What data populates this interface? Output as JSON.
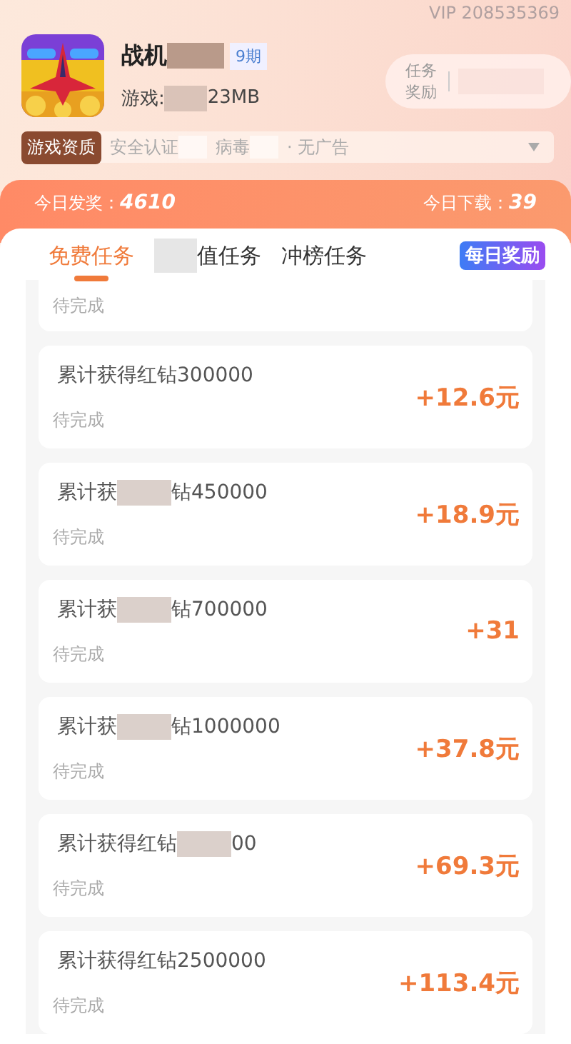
{
  "header": {
    "vip": "VIP 208535369",
    "game_icon": {
      "kind": "picture"
    },
    "title": [
      "战机"
    ],
    "period_badge": "9期",
    "info": [
      "游戏:",
      "23MB"
    ],
    "reward_label": "任务奖励"
  },
  "quality": {
    "tag": "游戏资质",
    "items": [
      "安全认证",
      "病毒",
      "· 无广告"
    ]
  },
  "stats": [
    {
      "label": "今日发奖：",
      "value": "4610"
    },
    {
      "label": "今日下载：",
      "value": "39"
    }
  ],
  "tabs": [
    {
      "label": "免费任务",
      "selected": true,
      "kind": "text",
      "hidden_prefix": false
    },
    {
      "label": "值任务",
      "selected": false,
      "kind": "text",
      "hidden_prefix": true
    },
    {
      "label": "冲榜任务",
      "selected": false,
      "kind": "text",
      "hidden_prefix": false
    },
    {
      "label": "每日奖励",
      "selected": false,
      "kind": "badge",
      "hidden_prefix": false
    }
  ],
  "partial_task": {
    "status": "待完成"
  },
  "tasks": [
    {
      "title": [
        "累计获得红钻300000"
      ],
      "status": "待完成",
      "reward": "+12.6元"
    },
    {
      "title": [
        "累计获",
        "钻450000"
      ],
      "status": "待完成",
      "reward": "+18.9元"
    },
    {
      "title": [
        "累计获",
        "钻700000"
      ],
      "status": "待完成",
      "reward": "+31"
    },
    {
      "title": [
        "累计获",
        "钻1000000"
      ],
      "status": "待完成",
      "reward": "+37.8元"
    },
    {
      "title": [
        "累计获得红钻",
        "00"
      ],
      "status": "待完成",
      "reward": "+69.3元"
    },
    {
      "title": [
        "累计获得红钻2500000"
      ],
      "status": "待完成",
      "reward": "+113.4元"
    }
  ]
}
